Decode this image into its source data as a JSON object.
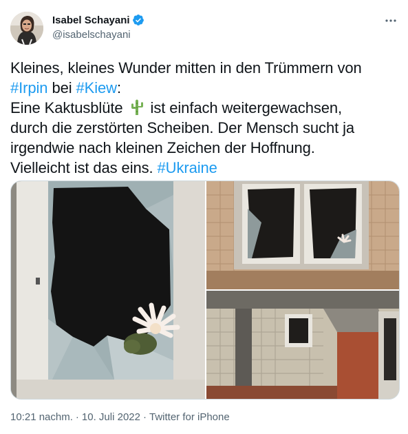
{
  "author": {
    "display_name": "Isabel Schayani",
    "handle": "@isabelschayani",
    "verified": true
  },
  "more_icon": "ellipsis-icon",
  "tweet": {
    "line1_text": "Kleines, kleines Wunder mitten in den Trümmern von",
    "hashtag_irpin": "#Irpin",
    "word_bei": " bei ",
    "hashtag_kiew": "#Kiew",
    "colon": ":",
    "line3_before_emoji": "Eine Kaktusblüte ",
    "emoji": "cactus-icon",
    "line3_after_emoji": " ist einfach weitergewachsen,",
    "line4": "durch die zerstörten Scheiben. Der Mensch sucht ja",
    "line5": "irgendwie nach kleinen Zeichen der Hoffnung.",
    "line6_text": "Vielleicht ist das eins. ",
    "hashtag_ukraine": "#Ukraine"
  },
  "meta": {
    "time": "10:21 nachm.",
    "separator": "·",
    "date": "10. Juli 2022",
    "client": "Twitter for iPhone"
  },
  "colors": {
    "link": "#1d9bf0",
    "secondary_text": "#536471",
    "verified": "#1d9bf0"
  }
}
